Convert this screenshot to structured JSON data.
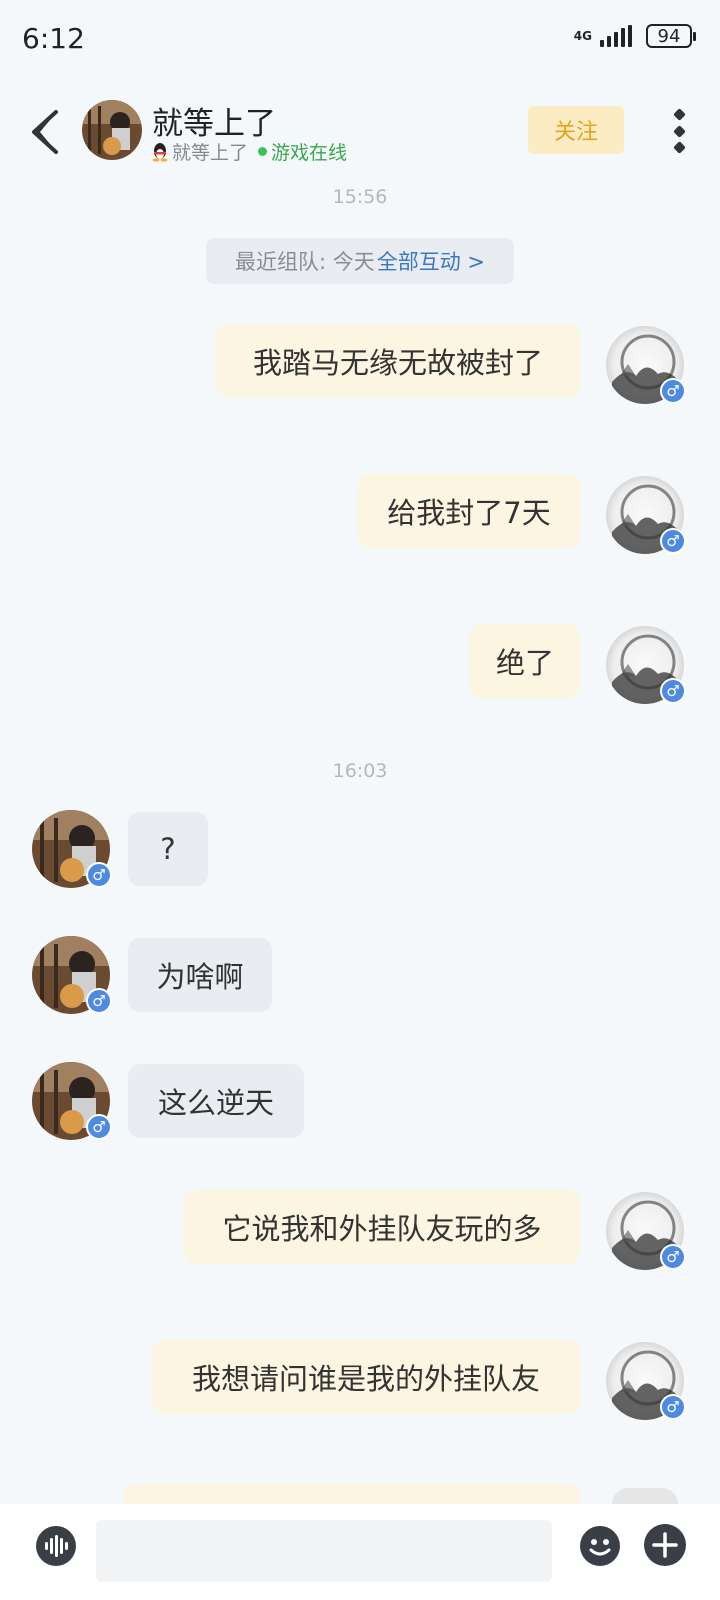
{
  "status_bar": {
    "time": "6:12",
    "network": "4G",
    "battery": "94"
  },
  "header": {
    "back_icon": "back-chevron-icon",
    "name": "就等上了",
    "sub_name": "就等上了",
    "online_status": "游戏在线",
    "follow_label": "关注",
    "more_icon": "more-vertical-icon"
  },
  "timestamps": [
    "15:56",
    "16:03"
  ],
  "team_info": {
    "prefix": "最近组队: 今天",
    "link": "全部互动 >"
  },
  "messages": [
    {
      "side": "right",
      "text": "我踏马无缘无故被封了"
    },
    {
      "side": "right",
      "text": "给我封了7天"
    },
    {
      "side": "right",
      "text": "绝了"
    },
    {
      "side": "left",
      "text": "?"
    },
    {
      "side": "left",
      "text": "为啥啊"
    },
    {
      "side": "left",
      "text": "这么逆天"
    },
    {
      "side": "right",
      "text": "它说我和外挂队友玩的多"
    },
    {
      "side": "right",
      "text": "我想请问谁是我的外挂队友"
    }
  ],
  "gender_symbol": "♂",
  "composer": {
    "placeholder": "",
    "voice_icon": "voice-icon",
    "emoji_icon": "emoji-icon",
    "plus_icon": "plus-icon"
  },
  "colors": {
    "follow_bg": "#fcecc4",
    "follow_text": "#e8a21a",
    "online": "#3dbf5a",
    "link": "#3a78c3",
    "gender_badge": "#4d8ae0"
  }
}
